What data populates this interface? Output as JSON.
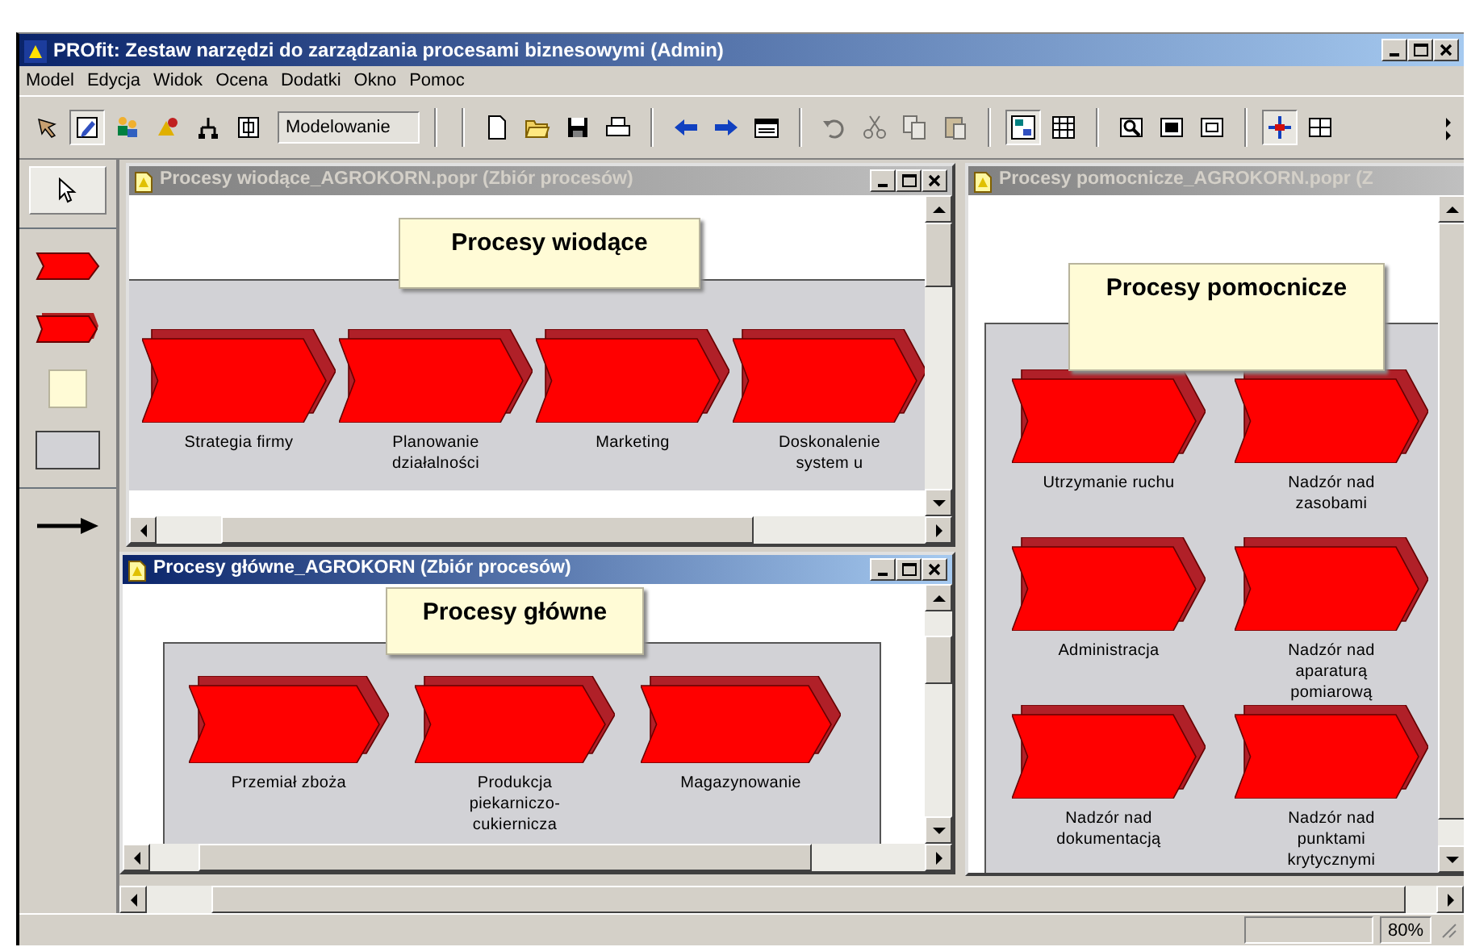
{
  "window": {
    "title": "PROfit: Zestaw narzędzi do zarządzania procesami biznesowymi (Admin)",
    "active": true
  },
  "menu": [
    "Model",
    "Edycja",
    "Widok",
    "Ocena",
    "Dodatki",
    "Okno",
    "Pomoc"
  ],
  "toolbar": [
    {
      "kind": "button",
      "pressed": false,
      "disabled": false
    },
    {
      "kind": "button",
      "pressed": true,
      "disabled": false
    },
    {
      "kind": "button",
      "pressed": false,
      "disabled": false
    },
    {
      "kind": "button",
      "pressed": false,
      "disabled": false
    },
    {
      "kind": "button",
      "pressed": false,
      "disabled": false
    },
    {
      "kind": "button",
      "pressed": false,
      "disabled": false
    },
    {
      "kind": "field",
      "value": "Modelowanie"
    },
    {
      "kind": "button",
      "pressed": false,
      "disabled": false
    },
    {
      "kind": "button",
      "pressed": false,
      "disabled": false
    },
    {
      "kind": "button",
      "pressed": false,
      "disabled": false
    },
    {
      "kind": "button",
      "pressed": false,
      "disabled": false
    },
    {
      "kind": "button",
      "pressed": false,
      "disabled": false
    },
    {
      "kind": "button",
      "pressed": false,
      "disabled": false
    },
    {
      "kind": "button",
      "pressed": false,
      "disabled": false
    },
    {
      "kind": "button",
      "pressed": false,
      "disabled": true
    },
    {
      "kind": "button",
      "pressed": false,
      "disabled": true
    },
    {
      "kind": "button",
      "pressed": false,
      "disabled": true
    },
    {
      "kind": "button",
      "pressed": false,
      "disabled": true
    },
    {
      "kind": "button",
      "pressed": true,
      "disabled": false
    },
    {
      "kind": "button",
      "pressed": false,
      "disabled": false
    },
    {
      "kind": "button",
      "pressed": false,
      "disabled": false
    },
    {
      "kind": "button",
      "pressed": false,
      "disabled": false
    },
    {
      "kind": "button",
      "pressed": false,
      "disabled": false
    },
    {
      "kind": "button",
      "pressed": true,
      "disabled": false
    },
    {
      "kind": "button",
      "pressed": false,
      "disabled": false
    }
  ],
  "palette": [
    {
      "selected": true
    },
    {
      "selected": false
    },
    {
      "selected": false
    },
    {
      "selected": false
    },
    {
      "selected": false
    },
    {
      "selected": false
    }
  ],
  "windows": [
    {
      "title": "Procesy wiodące_AGROKORN.popr (Zbiór procesów)",
      "active": false,
      "heading": "Procesy wiodące",
      "processes": [
        "Strategia firmy",
        "Planowanie\ndziałalności",
        "Marketing",
        "Doskonalenie\nsystem u"
      ]
    },
    {
      "title": "Procesy pomocnicze_AGROKORN.popr (Z",
      "active": false,
      "heading": "Procesy pomocnicze",
      "processes": [
        "Utrzymanie ruchu",
        "Nadzór nad\nzasobami",
        "Administracja",
        "Nadzór nad\naparaturą\npomiarową",
        "Nadzór nad\ndokumentacją",
        "Nadzór nad\npunktami\nkrytycznymi"
      ]
    },
    {
      "title": "Procesy główne_AGROKORN (Zbiór procesów)",
      "active": true,
      "heading": "Procesy główne",
      "processes": [
        "Przemiał zboża",
        "Produkcja\npiekarniczo-\ncukiernicza",
        "Magazynowanie"
      ]
    }
  ],
  "status_bar": {
    "zoom": "80%"
  }
}
